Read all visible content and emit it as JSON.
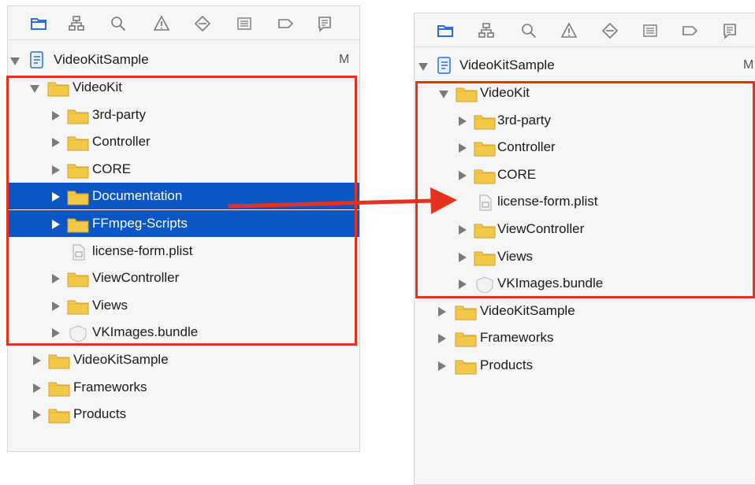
{
  "left_tree": {
    "project": {
      "label": "VideoKitSample",
      "badge": "M"
    },
    "group": "VideoKit",
    "items": [
      {
        "label": "3rd-party",
        "type": "folder"
      },
      {
        "label": "Controller",
        "type": "folder"
      },
      {
        "label": "CORE",
        "type": "folder"
      },
      {
        "label": "Documentation",
        "type": "folder",
        "selected": true
      },
      {
        "label": "FFmpeg-Scripts",
        "type": "folder",
        "selected": true
      },
      {
        "label": "license-form.plist",
        "type": "file"
      },
      {
        "label": "ViewController",
        "type": "folder"
      },
      {
        "label": "Views",
        "type": "folder"
      },
      {
        "label": "VKImages.bundle",
        "type": "bundle"
      }
    ],
    "top_items": [
      "VideoKitSample",
      "Frameworks",
      "Products"
    ]
  },
  "right_tree": {
    "project": {
      "label": "VideoKitSample",
      "badge": "M"
    },
    "group": "VideoKit",
    "items": [
      {
        "label": "3rd-party",
        "type": "folder"
      },
      {
        "label": "Controller",
        "type": "folder"
      },
      {
        "label": "CORE",
        "type": "folder"
      },
      {
        "label": "license-form.plist",
        "type": "file"
      },
      {
        "label": "ViewController",
        "type": "folder"
      },
      {
        "label": "Views",
        "type": "folder"
      },
      {
        "label": "VKImages.bundle",
        "type": "bundle"
      }
    ],
    "top_items": [
      "VideoKitSample",
      "Frameworks",
      "Products"
    ]
  },
  "toolbar_icons": [
    "folder-icon",
    "hierarchy-icon",
    "search-icon",
    "warning-icon",
    "test-icon",
    "debug-icon",
    "breakpoint-icon",
    "report-icon"
  ],
  "colors": {
    "selection": "#0b56c5",
    "highlight": "#e5321c",
    "folder": "#f3c94a",
    "active_icon": "#2a6fd6",
    "inactive_icon": "#7a7a7a"
  }
}
